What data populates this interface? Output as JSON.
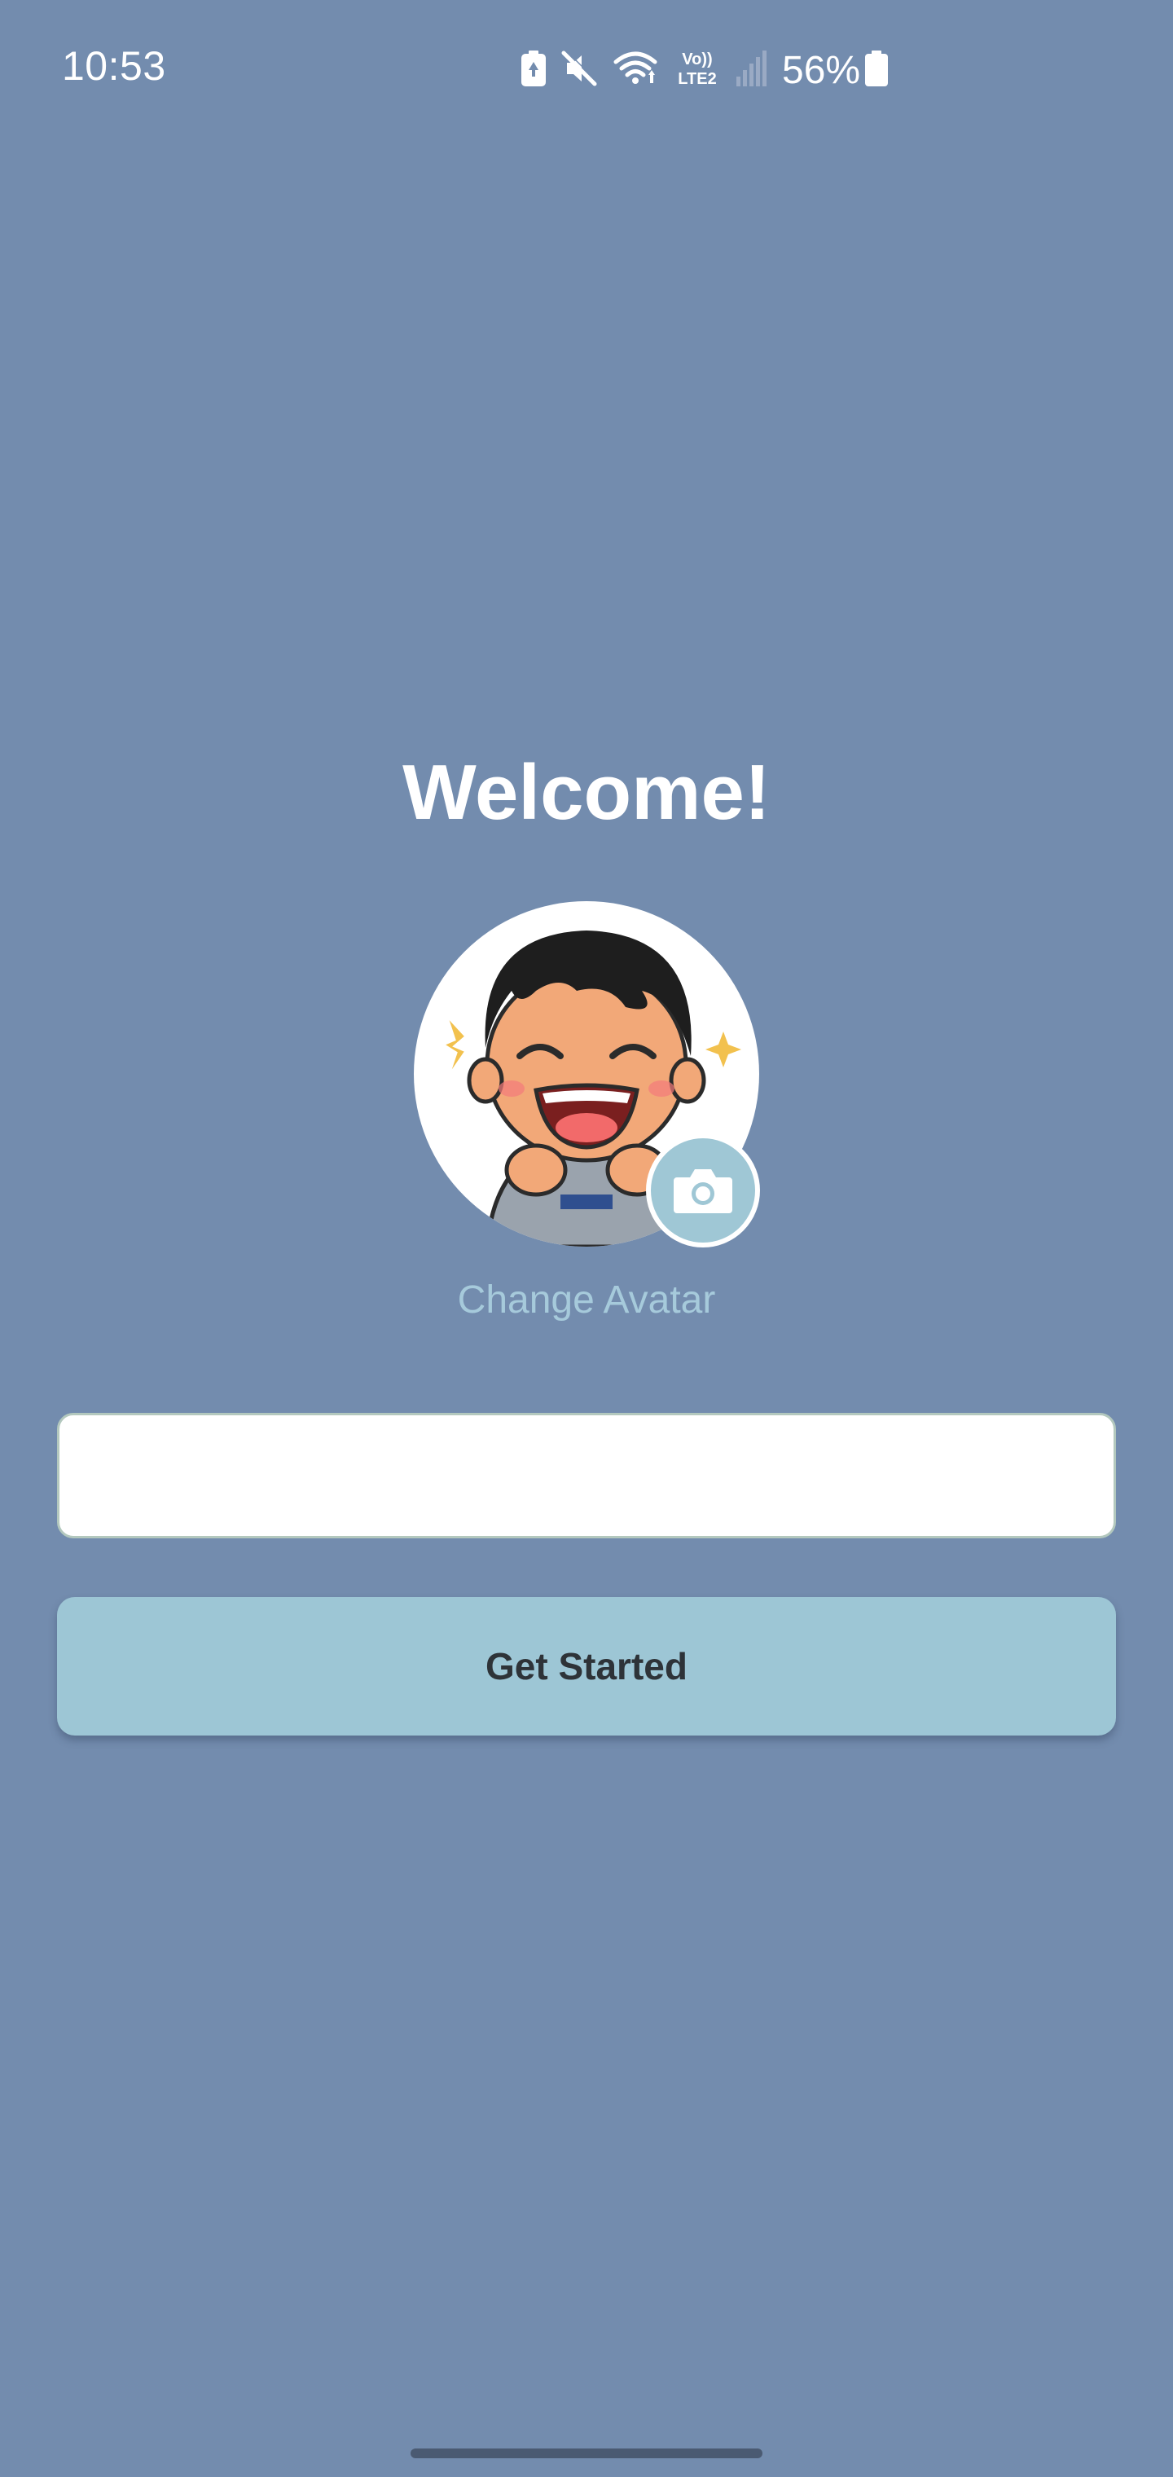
{
  "status_bar": {
    "time": "10:53",
    "battery_percent": "56%",
    "icons": [
      "battery-saver-icon",
      "mute-icon",
      "wifi-icon",
      "volte-lte2-icon",
      "signal-icon",
      "battery-icon"
    ],
    "volte_label_top": "Vo))",
    "volte_label_bottom": "LTE2"
  },
  "main": {
    "title": "Welcome!",
    "avatar_icon": "cartoon-boy-avatar",
    "camera_icon": "camera-icon",
    "change_avatar_label": "Change Avatar",
    "name_input": {
      "value": "",
      "placeholder": ""
    },
    "get_started_label": "Get Started"
  },
  "colors": {
    "background": "#738cae",
    "accent": "#9dc6d5",
    "link": "#a6cadb",
    "input_border": "#b3c8be"
  }
}
